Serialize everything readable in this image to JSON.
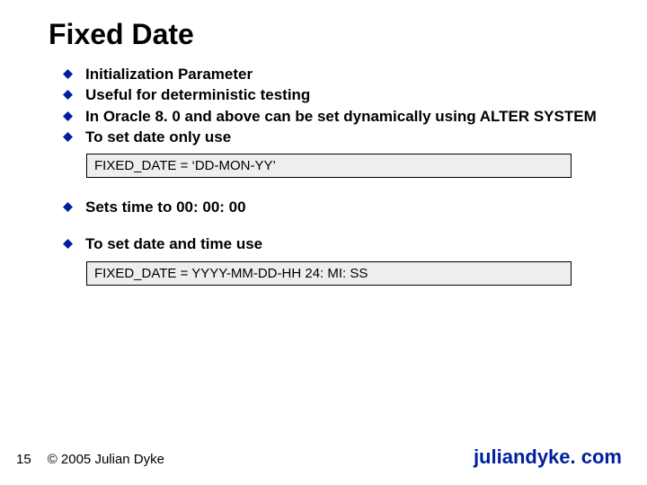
{
  "title": "Fixed Date",
  "bullets": {
    "group1": [
      "Initialization Parameter",
      "Useful for deterministic testing",
      "In Oracle 8. 0 and above can be set dynamically using ALTER SYSTEM",
      "To set date only use"
    ],
    "code1": "FIXED_DATE = ‘DD-MON-YY’",
    "b5": "Sets time to 00: 00: 00",
    "b6": "To set date and time use",
    "code2": "FIXED_DATE = YYYY-MM-DD-HH 24: MI: SS"
  },
  "footer": {
    "page": "15",
    "copyright": "© 2005 Julian Dyke",
    "site": "juliandyke. com"
  },
  "colors": {
    "bullet": "#001f9f",
    "codebox_bg": "#eeeeee",
    "site": "#001f9f"
  }
}
